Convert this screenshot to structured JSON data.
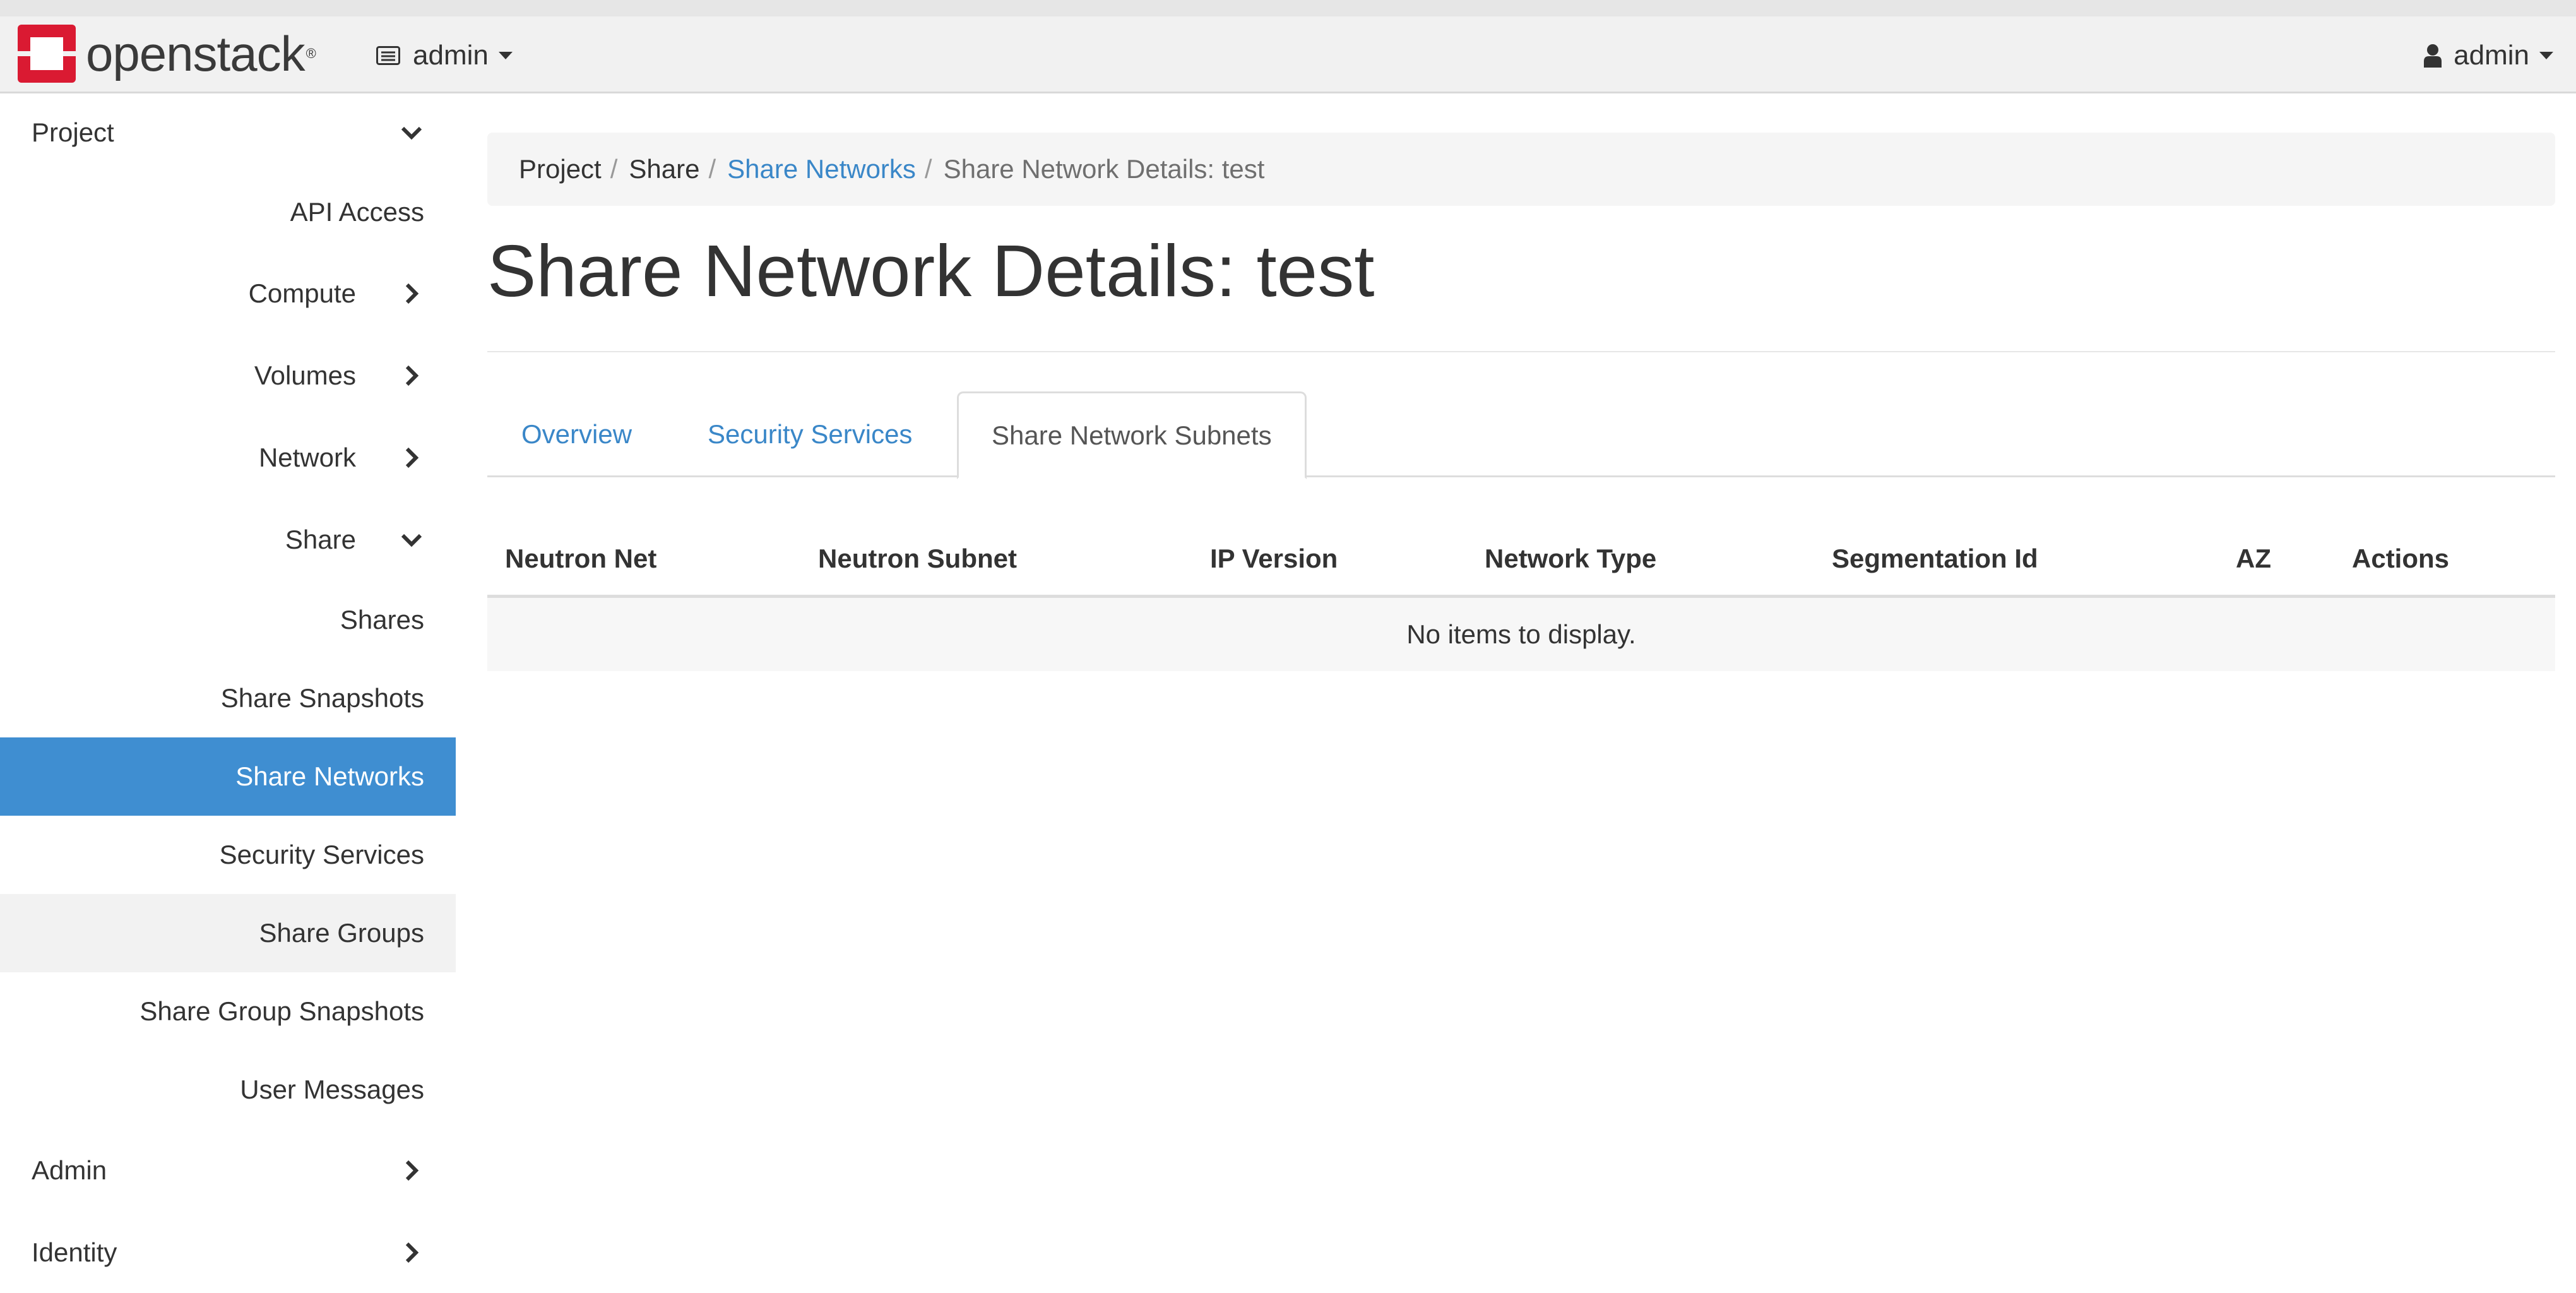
{
  "brand": {
    "name": "openstack",
    "registered": "®"
  },
  "project_switcher": {
    "label": "admin"
  },
  "user_menu": {
    "label": "admin"
  },
  "sidebar": {
    "items": [
      {
        "label": "Project"
      },
      {
        "label": "API Access"
      },
      {
        "label": "Compute"
      },
      {
        "label": "Volumes"
      },
      {
        "label": "Network"
      },
      {
        "label": "Share"
      },
      {
        "label": "Shares"
      },
      {
        "label": "Share Snapshots"
      },
      {
        "label": "Share Networks"
      },
      {
        "label": "Security Services"
      },
      {
        "label": "Share Groups"
      },
      {
        "label": "Share Group Snapshots"
      },
      {
        "label": "User Messages"
      },
      {
        "label": "Admin"
      },
      {
        "label": "Identity"
      }
    ]
  },
  "breadcrumb": {
    "items": [
      "Project",
      "Share",
      "Share Networks",
      "Share Network Details: test"
    ],
    "separator": "/"
  },
  "page": {
    "title": "Share Network Details: test"
  },
  "tabs": [
    {
      "label": "Overview"
    },
    {
      "label": "Security Services"
    },
    {
      "label": "Share Network Subnets"
    }
  ],
  "table": {
    "columns": [
      "Neutron Net",
      "Neutron Subnet",
      "IP Version",
      "Network Type",
      "Segmentation Id",
      "AZ",
      "Actions"
    ],
    "empty_message": "No items to display."
  },
  "colors": {
    "accent": "#3f8ed1",
    "link": "#3a87c8",
    "logo_red": "#da1a32",
    "topbar": "#f1f1f1"
  },
  "icons": {
    "logo": "openstack-logo-icon",
    "project": "project-list-icon",
    "user": "user-icon",
    "expand": "chevron-down-icon",
    "collapse": "chevron-right-icon"
  }
}
